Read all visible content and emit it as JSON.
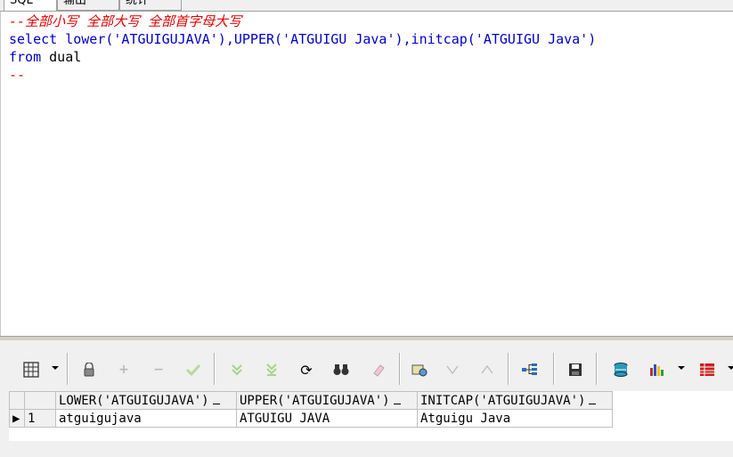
{
  "tabs": [
    "SQL",
    "输出",
    "统计"
  ],
  "editor": {
    "line1": "--全部小写 全部大写 全部首字母大写",
    "line2_kw": "select",
    "line2_rest": " lower('ATGUIGUJAVA'),UPPER('ATGUIGU Java'),initcap('ATGUIGU Java')",
    "line3_kw": "from",
    "line3_rest": " dual",
    "line4": "--"
  },
  "toolbar": {
    "icons": [
      "grid-icon",
      "lock-icon",
      "plus-icon",
      "minus-icon",
      "check-icon",
      "arrow-down-double-icon",
      "arrow-down-last-icon",
      "refresh-icon",
      "binoculars-icon",
      "eraser-icon",
      "query-icon",
      "triangle-down-icon",
      "triangle-up-icon",
      "tree-icon",
      "save-icon",
      "database-icon",
      "bar-chart-icon",
      "table-export-icon"
    ]
  },
  "grid": {
    "columns": [
      "LOWER('ATGUIGUJAVA')",
      "UPPER('ATGUIGUJAVA')",
      "INITCAP('ATGUIGUJAVA')"
    ],
    "rows": [
      {
        "num": "1",
        "cells": [
          "atguigujava",
          "ATGUIGU JAVA",
          "Atguigu Java"
        ]
      }
    ]
  },
  "colors": {
    "comment": "#e00000",
    "keyword": "#0000c8",
    "grid_border": "#c0c0c0"
  }
}
